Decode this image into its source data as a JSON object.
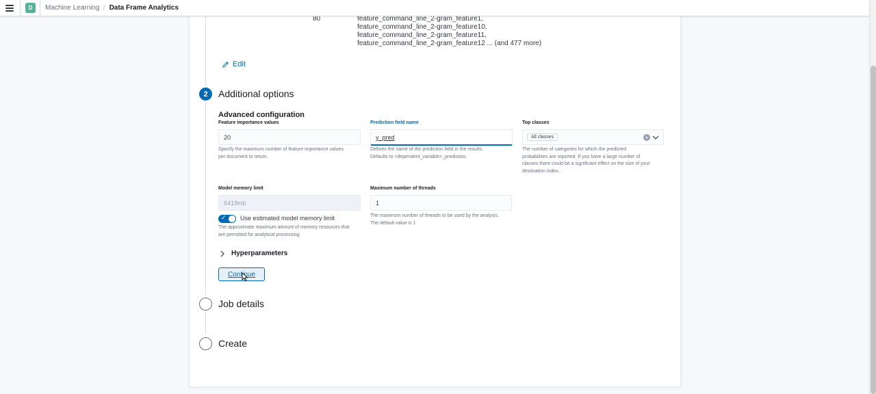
{
  "header": {
    "menu_icon": "menu-icon",
    "space_initial": "D",
    "breadcrumbs": [
      "Machine Learning",
      "Data Frame Analytics"
    ],
    "divider": "/"
  },
  "details": {
    "feature_count": "80",
    "feature_lines": [
      "feature_command_line_2-gram_feature1,",
      "feature_command_line_2-gram_feature10,",
      "feature_command_line_2-gram_feature11,",
      "feature_command_line_2-gram_feature12 ... (and 477 more)"
    ],
    "edit_label": "Edit"
  },
  "steps": [
    {
      "number": "2",
      "title": "Additional options",
      "state": "active"
    },
    {
      "number": "",
      "title": "Job details",
      "state": "todo"
    },
    {
      "number": "",
      "title": "Create",
      "state": "todo"
    }
  ],
  "advanced": {
    "title": "Advanced configuration",
    "feature_importance": {
      "label": "Feature importance values",
      "value": "20",
      "help": [
        "Specify the maximum number of feature importance values",
        "per document to return."
      ]
    },
    "prediction_field": {
      "label": "Prediction field name",
      "value": "y_pred",
      "help": [
        "Defines the name of the prediction field in the results.",
        "Defaults to <dependent_variable>_prediction."
      ]
    },
    "top_classes": {
      "label": "Top classes",
      "value": "All classes",
      "clear": "×",
      "help": [
        "The number of categories for which the predicted",
        "probabilities are reported. If you have a large number of",
        "classes there could be a significant effect on the size of your",
        "destination index."
      ]
    },
    "model_memory": {
      "label": "Model memory limit",
      "placeholder": "6419mb",
      "toggle_label": "Use estimated model memory limit",
      "toggle_on": true,
      "help": [
        "The approximate maximum amount of memory resources that",
        "are permitted for analytical processing."
      ]
    },
    "max_threads": {
      "label": "Maximum number of threads",
      "value": "1",
      "help": [
        "The maximum number of threads to be used by the analysis.",
        "The default value is 1"
      ]
    },
    "hyperparameters_label": "Hyperparameters",
    "continue_label": "Continue"
  }
}
